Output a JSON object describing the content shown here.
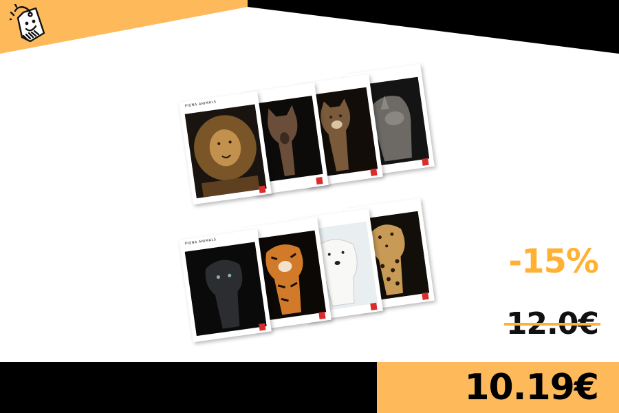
{
  "colors": {
    "accent": "#feb95a",
    "discount": "#ffb133",
    "dark": "#000000",
    "background": "#ffffff"
  },
  "logo": {
    "icon": "smiling-price-tag-icon"
  },
  "product": {
    "image": "animal-notebooks-set",
    "notebooks": [
      {
        "animal": "lion"
      },
      {
        "animal": "wolf"
      },
      {
        "animal": "puma"
      },
      {
        "animal": "rhinoceros"
      },
      {
        "animal": "black-panther"
      },
      {
        "animal": "tiger"
      },
      {
        "animal": "polar-bear"
      },
      {
        "animal": "leopard"
      }
    ]
  },
  "pricing": {
    "discount": "-15%",
    "old_price": "12.0€",
    "new_price": "10.19€"
  }
}
